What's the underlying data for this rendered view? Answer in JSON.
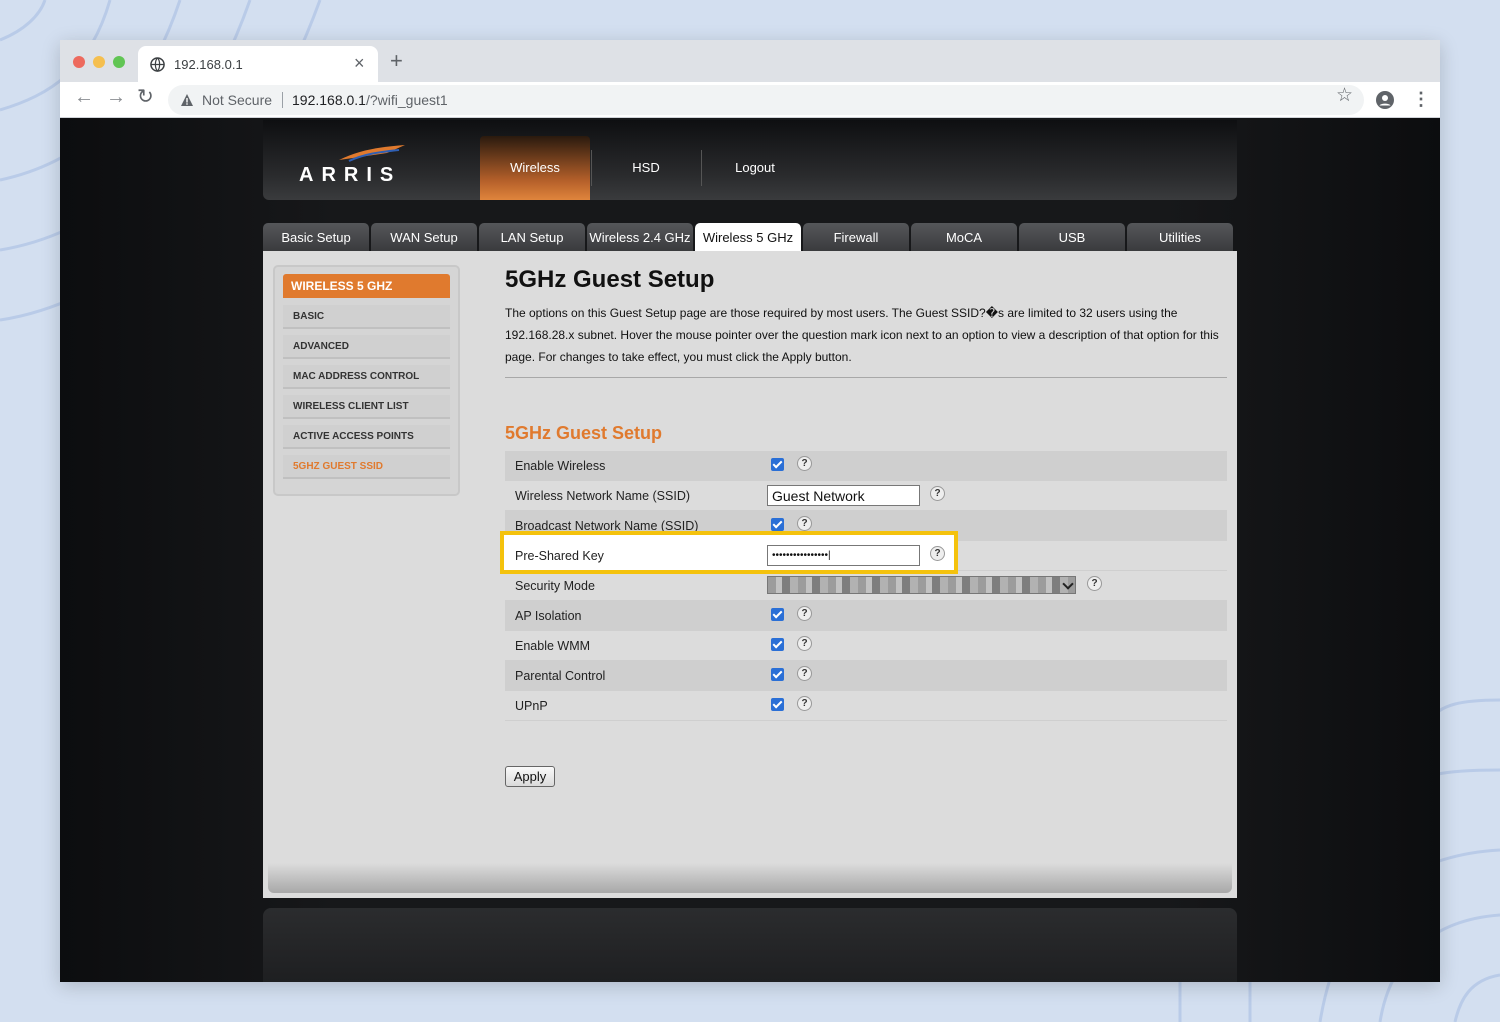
{
  "browser": {
    "tab_title": "192.168.0.1",
    "security_label": "Not Secure",
    "url_host": "192.168.0.1",
    "url_path": "/?wifi_guest1",
    "buttons": {
      "back": "←",
      "forward": "→",
      "reload": "↻",
      "star": "☆",
      "menu": "⋮",
      "close_tab": "×",
      "new_tab": "+"
    }
  },
  "header": {
    "logo": "ARRIS",
    "nav": [
      {
        "label": "Wireless",
        "active": true
      },
      {
        "label": "HSD",
        "active": false
      },
      {
        "label": "Logout",
        "active": false
      }
    ]
  },
  "tabs": [
    {
      "label": "Basic Setup"
    },
    {
      "label": "WAN Setup"
    },
    {
      "label": "LAN Setup"
    },
    {
      "label": "Wireless 2.4 GHz"
    },
    {
      "label": "Wireless 5 GHz",
      "active": true
    },
    {
      "label": "Firewall"
    },
    {
      "label": "MoCA"
    },
    {
      "label": "USB"
    },
    {
      "label": "Utilities"
    }
  ],
  "sidebar": {
    "heading": "WIRELESS 5 GHZ",
    "items": [
      {
        "label": "BASIC"
      },
      {
        "label": "ADVANCED"
      },
      {
        "label": "MAC ADDRESS CONTROL"
      },
      {
        "label": "WIRELESS CLIENT LIST"
      },
      {
        "label": "ACTIVE ACCESS POINTS"
      },
      {
        "label": "5GHZ GUEST SSID",
        "active": true
      }
    ]
  },
  "main": {
    "title": "5GHz Guest Setup",
    "description": "The options on this Guest Setup page are those required by most users. The Guest SSID?�s are limited to 32 users using the 192.168.28.x subnet. Hover the mouse pointer over the question mark icon next to an option to view a description of that option for this page. For changes to take effect, you must click the Apply button.",
    "section_title": "5GHz Guest Setup",
    "help_glyph": "?",
    "rows": {
      "enable_wireless": {
        "label": "Enable Wireless",
        "checked": true
      },
      "ssid": {
        "label": "Wireless Network Name (SSID)",
        "value": "Guest Network"
      },
      "broadcast": {
        "label": "Broadcast Network Name (SSID)",
        "checked": true
      },
      "psk": {
        "label": "Pre-Shared Key",
        "value": "••••••••••••••••|"
      },
      "security_mode": {
        "label": "Security Mode"
      },
      "ap_isolation": {
        "label": "AP Isolation",
        "checked": true
      },
      "wmm": {
        "label": "Enable WMM",
        "checked": true
      },
      "parental": {
        "label": "Parental Control",
        "checked": true
      },
      "upnp": {
        "label": "UPnP",
        "checked": true
      }
    },
    "apply_label": "Apply"
  },
  "colors": {
    "accent": "#e07a2e",
    "highlight": "#f4c20d",
    "checkbox": "#2a6fd6"
  }
}
